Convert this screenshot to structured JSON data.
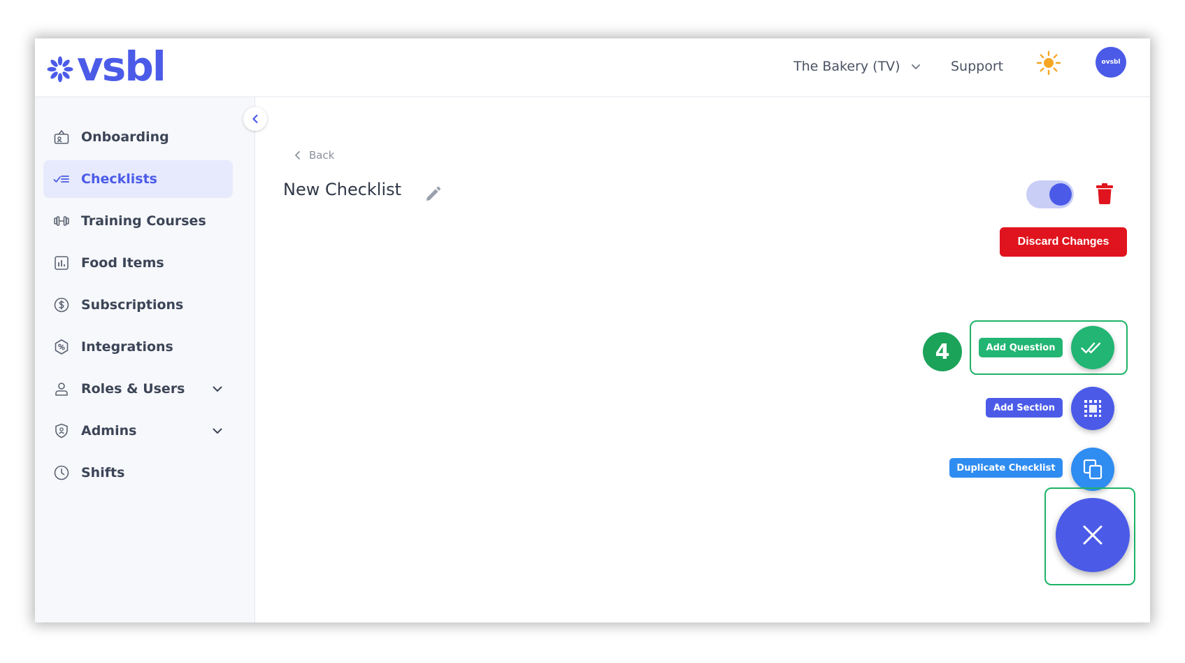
{
  "brand": {
    "name": "vsbl",
    "color": "#4b5be8"
  },
  "header": {
    "organization": "The Bakery (TV)",
    "support_label": "Support",
    "avatar_text": "ovsbl",
    "theme_icon": "sun-icon"
  },
  "sidebar": {
    "items": [
      {
        "label": "Onboarding",
        "icon": "onboarding-icon",
        "active": false
      },
      {
        "label": "Checklists",
        "icon": "checklist-icon",
        "active": true
      },
      {
        "label": "Training Courses",
        "icon": "dumbbell-icon",
        "active": false
      },
      {
        "label": "Food Items",
        "icon": "chart-icon",
        "active": false
      },
      {
        "label": "Subscriptions",
        "icon": "dollar-icon",
        "active": false
      },
      {
        "label": "Integrations",
        "icon": "integrations-icon",
        "active": false
      },
      {
        "label": "Roles & Users",
        "icon": "user-icon",
        "active": false,
        "expandable": true
      },
      {
        "label": "Admins",
        "icon": "shield-icon",
        "active": false,
        "expandable": true
      },
      {
        "label": "Shifts",
        "icon": "clock-icon",
        "active": false
      }
    ]
  },
  "main": {
    "back_label": "Back",
    "title": "New Checklist",
    "toggle_on": true,
    "discard_label": "Discard Changes"
  },
  "fab_menu": {
    "step_number": "4",
    "add_question_label": "Add Question",
    "add_section_label": "Add Section",
    "duplicate_label": "Duplicate Checklist"
  },
  "colors": {
    "accent": "#4b5be8",
    "danger": "#e0141e",
    "success": "#22b573",
    "duplicate": "#2f8cf0",
    "highlight": "#1db366"
  }
}
